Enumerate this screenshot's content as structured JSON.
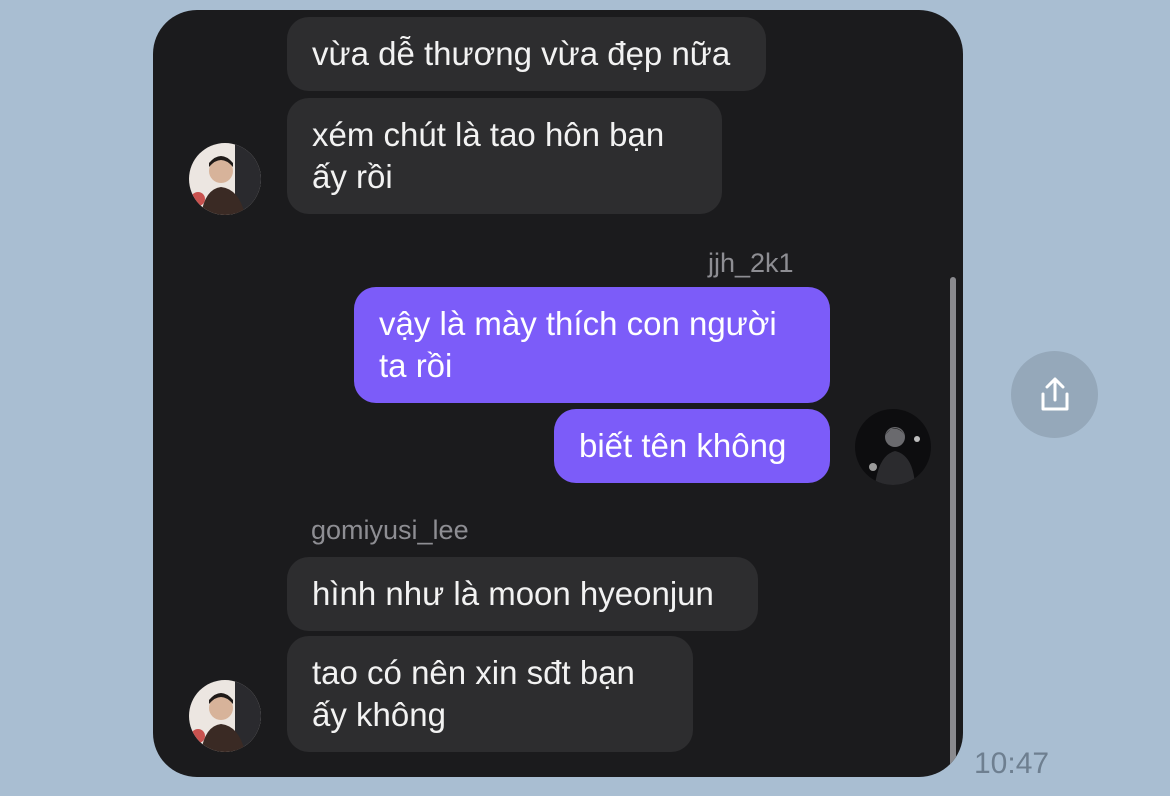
{
  "messages": [
    {
      "text": "vừa dễ thương vừa đẹp nữa"
    },
    {
      "text": "xém chút là tao hôn bạn\nấy rồi"
    },
    {
      "username": "jjh_2k1"
    },
    {
      "text": "vậy là mày thích con người\nta rồi"
    },
    {
      "text": "biết tên không"
    },
    {
      "username": "gomiyusi_lee"
    },
    {
      "text": "hình như là moon hyeonjun"
    },
    {
      "text": "tao có nên xin sđt bạn\nấy không"
    }
  ],
  "timestamp": "10:47",
  "colors": {
    "background": "#a9bed2",
    "chat_background": "#1b1b1d",
    "incoming_bubble": "#2d2d2f",
    "outgoing_bubble": "#7c5cf9"
  },
  "icons": {
    "share": "share-icon"
  }
}
